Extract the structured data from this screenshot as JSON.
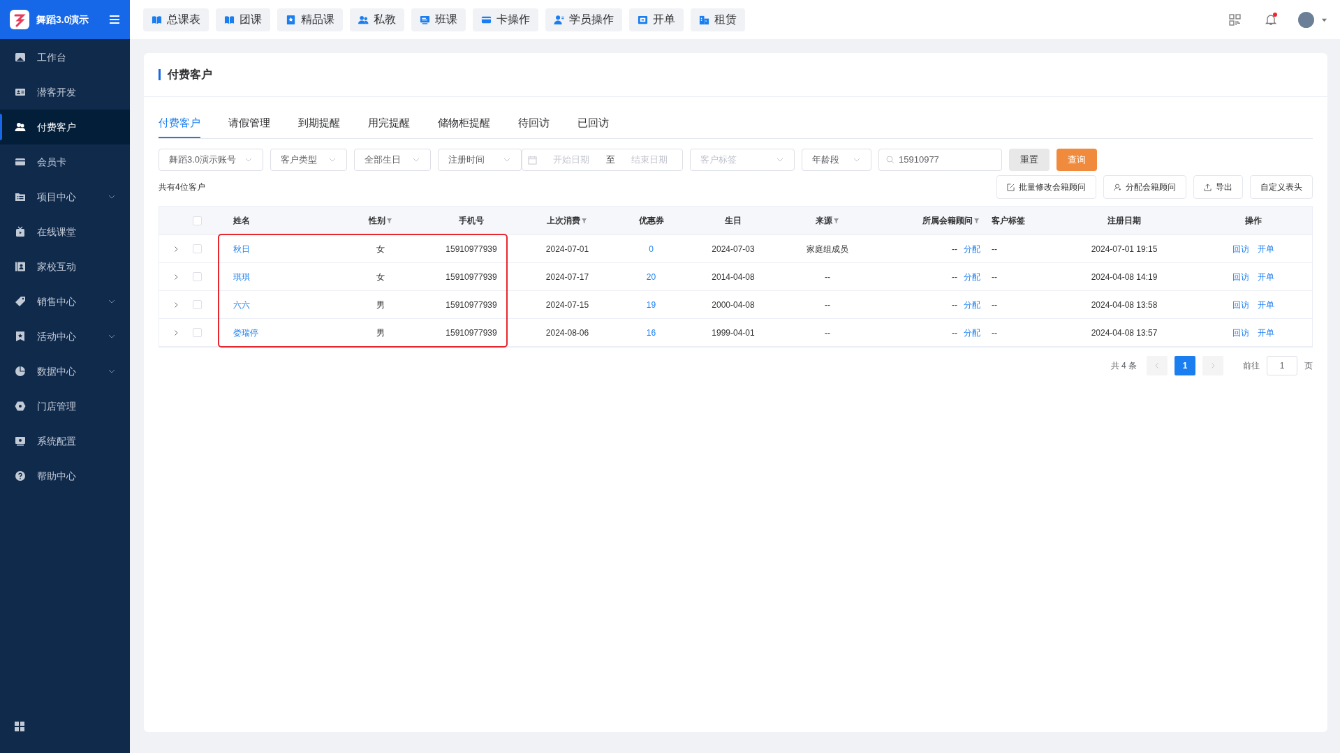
{
  "brand": {
    "name": "舞蹈3.0演示"
  },
  "top_nav": [
    {
      "label": "总课表"
    },
    {
      "label": "团课"
    },
    {
      "label": "精品课"
    },
    {
      "label": "私教"
    },
    {
      "label": "班课"
    },
    {
      "label": "卡操作"
    },
    {
      "label": "学员操作"
    },
    {
      "label": "开单"
    },
    {
      "label": "租赁"
    }
  ],
  "header": {
    "has_notification": true
  },
  "sidebar": {
    "items": [
      {
        "label": "工作台",
        "selected": false,
        "expandable": false
      },
      {
        "label": "潜客开发",
        "selected": false,
        "expandable": false
      },
      {
        "label": "付费客户",
        "selected": true,
        "expandable": false
      },
      {
        "label": "会员卡",
        "selected": false,
        "expandable": false
      },
      {
        "label": "项目中心",
        "selected": false,
        "expandable": true
      },
      {
        "label": "在线课堂",
        "selected": false,
        "expandable": false
      },
      {
        "label": "家校互动",
        "selected": false,
        "expandable": false
      },
      {
        "label": "销售中心",
        "selected": false,
        "expandable": true
      },
      {
        "label": "活动中心",
        "selected": false,
        "expandable": true
      },
      {
        "label": "数据中心",
        "selected": false,
        "expandable": true
      },
      {
        "label": "门店管理",
        "selected": false,
        "expandable": false
      },
      {
        "label": "系统配置",
        "selected": false,
        "expandable": false
      },
      {
        "label": "帮助中心",
        "selected": false,
        "expandable": false
      }
    ]
  },
  "page": {
    "title": "付费客户"
  },
  "tabs": [
    {
      "label": "付费客户",
      "selected": true
    },
    {
      "label": "请假管理",
      "selected": false
    },
    {
      "label": "到期提醒",
      "selected": false
    },
    {
      "label": "用完提醒",
      "selected": false
    },
    {
      "label": "储物柜提醒",
      "selected": false
    },
    {
      "label": "待回访",
      "selected": false
    },
    {
      "label": "已回访",
      "selected": false
    }
  ],
  "filters": {
    "selects": [
      {
        "value": "舞蹈3.0演示账号"
      },
      {
        "value": "客户类型"
      },
      {
        "value": "全部生日"
      },
      {
        "value": "注册时间"
      }
    ],
    "date_range": {
      "start_placeholder": "开始日期",
      "separator": "至",
      "end_placeholder": "结束日期"
    },
    "tag_select": {
      "placeholder": "客户标签"
    },
    "age_select": {
      "value": "年龄段"
    },
    "search": {
      "value": "15910977"
    },
    "reset": "重置",
    "query": "查询"
  },
  "summary": "共有4位客户",
  "actions": [
    {
      "label": "批量修改会籍顾问"
    },
    {
      "label": "分配会籍顾问"
    },
    {
      "label": "导出"
    },
    {
      "label": "自定义表头"
    }
  ],
  "table": {
    "select_all_checked": false,
    "columns": [
      {
        "kind": "name",
        "label": "姓名",
        "filter": false,
        "highlighted": true
      },
      {
        "kind": "gender",
        "label": "性别",
        "filter": true,
        "highlighted": true
      },
      {
        "kind": "phone",
        "label": "手机号",
        "filter": false,
        "highlighted": true
      },
      {
        "kind": "last",
        "label": "上次消费",
        "filter": true,
        "highlighted": false
      },
      {
        "kind": "coupon",
        "label": "优惠券",
        "filter": false,
        "highlighted": false
      },
      {
        "kind": "birthday",
        "label": "生日",
        "filter": false,
        "highlighted": false
      },
      {
        "kind": "source",
        "label": "来源",
        "filter": true,
        "highlighted": false
      },
      {
        "kind": "advisor",
        "label": "所属会籍顾问",
        "filter": true,
        "highlighted": false
      },
      {
        "kind": "tags",
        "label": "客户标签",
        "filter": false,
        "highlighted": false
      },
      {
        "kind": "registered",
        "label": "注册日期",
        "filter": false,
        "highlighted": false
      },
      {
        "kind": "ops",
        "label": "操作",
        "filter": false,
        "highlighted": false
      }
    ],
    "rows": [
      {
        "name": "秋日",
        "gender": "女",
        "phone": "15910977939",
        "last": "2024-07-01",
        "coupon": "0",
        "birthday": "2024-07-03",
        "source": "家庭组成员",
        "advisor": "--",
        "assign": "分配",
        "tags": "--",
        "registered": "2024-07-01 19:15",
        "ops": [
          "回访",
          "开单"
        ],
        "checked": false
      },
      {
        "name": "琪琪",
        "gender": "女",
        "phone": "15910977939",
        "last": "2024-07-17",
        "coupon": "20",
        "birthday": "2014-04-08",
        "source": "--",
        "advisor": "--",
        "assign": "分配",
        "tags": "--",
        "registered": "2024-04-08 14:19",
        "ops": [
          "回访",
          "开单"
        ],
        "checked": false
      },
      {
        "name": "六六",
        "gender": "男",
        "phone": "15910977939",
        "last": "2024-07-15",
        "coupon": "19",
        "birthday": "2000-04-08",
        "source": "--",
        "advisor": "--",
        "assign": "分配",
        "tags": "--",
        "registered": "2024-04-08 13:58",
        "ops": [
          "回访",
          "开单"
        ],
        "checked": false
      },
      {
        "name": "娄瑞停",
        "gender": "男",
        "phone": "15910977939",
        "last": "2024-08-06",
        "coupon": "16",
        "birthday": "1999-04-01",
        "source": "--",
        "advisor": "--",
        "assign": "分配",
        "tags": "--",
        "registered": "2024-04-08 13:57",
        "ops": [
          "回访",
          "开单"
        ],
        "checked": false
      }
    ]
  },
  "pagination": {
    "total": "共 4 条",
    "pages": [
      {
        "label": "1",
        "selected": true
      }
    ],
    "goto_label": "前往",
    "goto_value": "1",
    "page_suffix": "页"
  }
}
